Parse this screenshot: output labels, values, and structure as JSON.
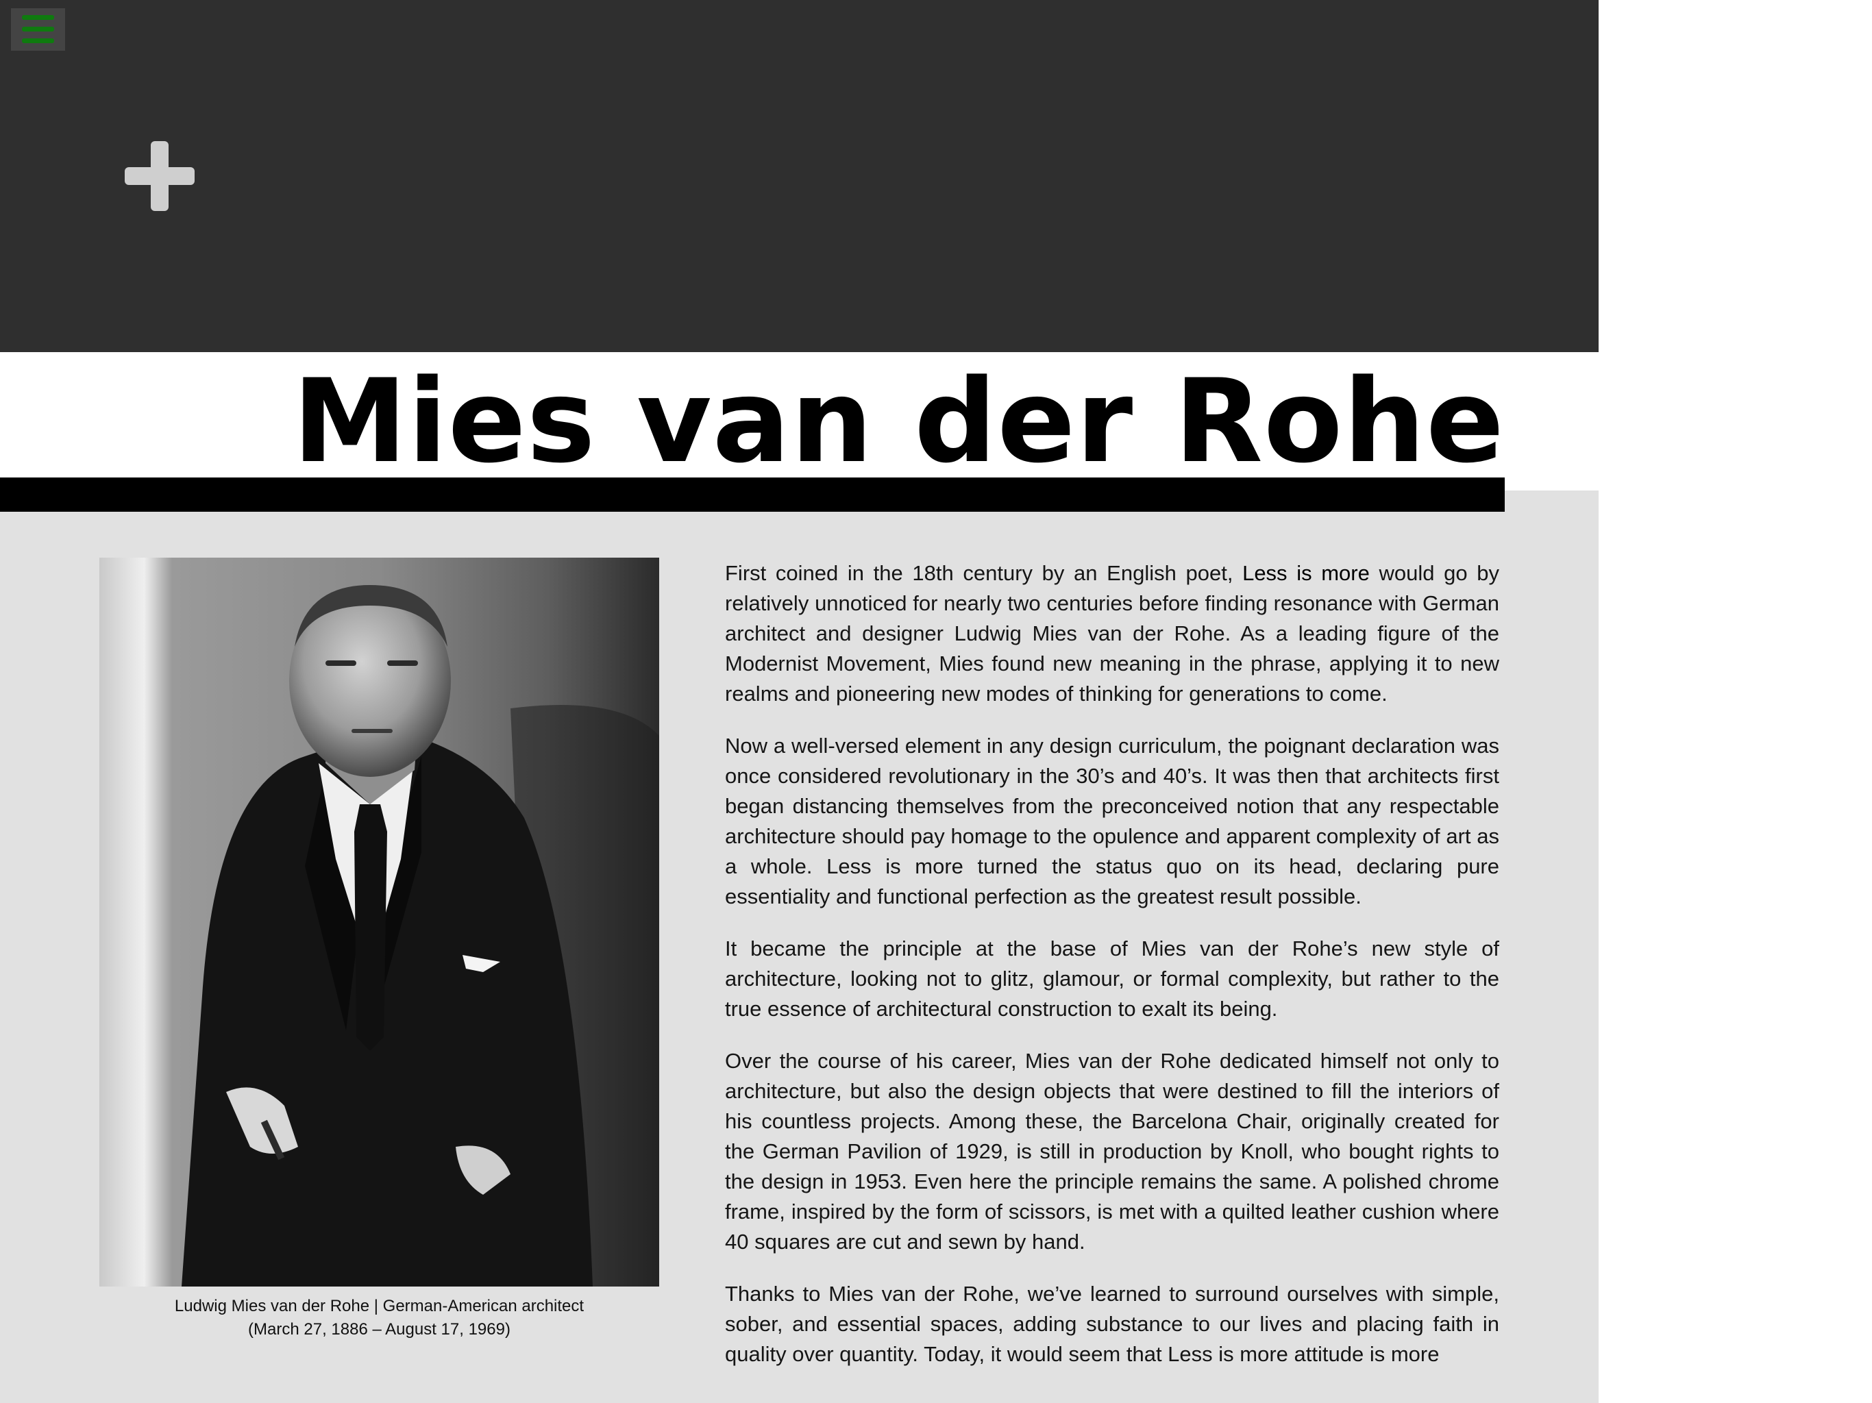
{
  "header": {
    "background": "#2f2f2f",
    "menu_icon": "hamburger-menu-icon",
    "menu_icon_color": "#0f7a0f",
    "add_icon": "plus-icon",
    "add_icon_color": "#cfcfcf"
  },
  "title": "Mies van der Rohe",
  "portrait": {
    "caption_line1": "Ludwig Mies van der Rohe | German-American architect",
    "caption_line2": "(March 27, 1886 – August 17, 1969)"
  },
  "article": {
    "p1_before": "First coined in the 18th century by an English poet, ",
    "p1_emphasis": "Less is more",
    "p1_after": " would go by relatively unnoticed for nearly two centuries before finding resonance with German architect and designer Ludwig Mies van der Rohe. As a leading figure of the Modernist Movement, Mies found new meaning in the phrase, applying it to new realms and pioneering new modes of thinking for generations to come.",
    "p2": "Now a well-versed element in any design curriculum, the poignant declaration was once considered revolutionary in the 30’s and 40’s. It was then that architects first began distancing themselves from the preconceived notion that any respectable architecture should pay homage to the opulence and apparent complexity of art as a whole. Less is more turned the status quo on its head, declaring pure essentiality and functional perfection as the greatest result possible.",
    "p3": "It became the principle at the base of Mies van der Rohe’s new style of architecture, looking not to glitz, glamour, or formal complexity, but rather to the true essence of architectural construction to exalt its being.",
    "p4": "Over the course of his career, Mies van der Rohe dedicated himself not only to architecture, but also the design objects that were destined to fill the interiors of his countless projects. Among these, the Barcelona Chair, originally created for the German Pavilion of 1929, is still in production by Knoll, who bought rights to the design in 1953. Even here the principle remains the same. A polished chrome frame, inspired by the form of scissors, is met with a quilted leather cushion where 40 squares are cut and sewn by hand.",
    "p5": "Thanks to Mies van der Rohe, we’ve learned to surround ourselves with simple, sober, and essential spaces, adding substance to our lives and placing faith in quality over quantity. Today, it would seem that Less is more attitude is more"
  }
}
